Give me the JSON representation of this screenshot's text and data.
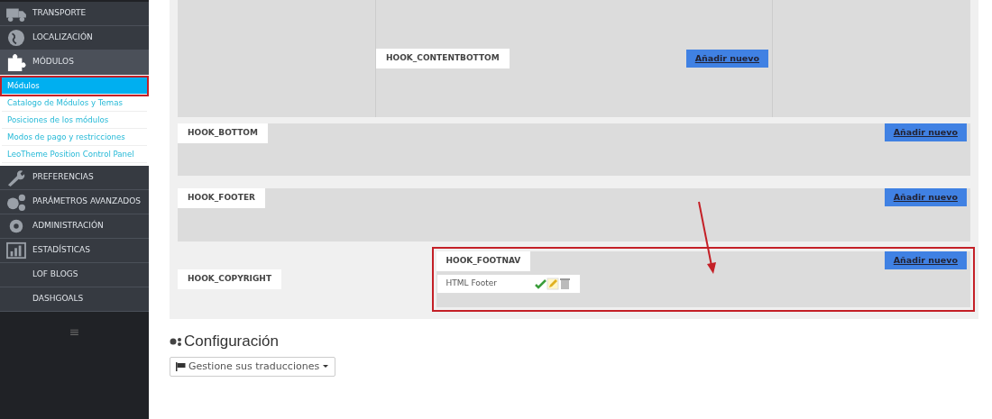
{
  "sidebar": {
    "items": [
      {
        "label": "TRANSPORTE",
        "selected": false
      },
      {
        "label": "LOCALIZACIÓN",
        "selected": false
      },
      {
        "label": "MÓDULOS",
        "selected": true,
        "children": [
          {
            "label": "Módulos",
            "selected": true,
            "highlighted": true
          },
          {
            "label": "Catalogo de Módulos y Temas",
            "selected": false,
            "highlighted": false
          },
          {
            "label": "Posiciones de los módulos",
            "selected": false,
            "highlighted": false
          },
          {
            "label": "Modos de pago y restricciones",
            "selected": false,
            "highlighted": false
          },
          {
            "label": "LeoTheme Position Control Panel",
            "selected": false,
            "highlighted": false
          }
        ]
      },
      {
        "label": "PREFERENCIAS",
        "selected": false
      },
      {
        "label": "PARÁMETROS AVANZADOS",
        "selected": false
      },
      {
        "label": "ADMINISTRACIÓN",
        "selected": false
      },
      {
        "label": "ESTADÍSTICAS",
        "selected": false
      },
      {
        "label": "LOF BLOGS",
        "selected": false
      },
      {
        "label": "DASHGOALS",
        "selected": false
      }
    ],
    "collapse": "≡"
  },
  "rows": [
    {
      "hooks": [
        {
          "name": "HOOK_CONTENTBOTTOM",
          "kind": "columns",
          "button": "Añadir nuevo",
          "highlighted": false
        }
      ]
    },
    {
      "hooks": [
        {
          "name": "HOOK_BOTTOM",
          "kind": "full",
          "button": "Añadir nuevo",
          "highlighted": false
        }
      ]
    },
    {
      "hooks": [
        {
          "name": "HOOK_FOOTER",
          "kind": "full",
          "button": "Añadir nuevo",
          "highlighted": false
        }
      ]
    },
    {
      "hooks": [
        {
          "name": "HOOK_COPYRIGHT",
          "kind": "bare",
          "highlighted": false
        },
        {
          "name": "HOOK_FOOTNAV",
          "kind": "full",
          "button": "Añadir nuevo",
          "highlighted": true,
          "modules": [
            {
              "name": "HTML Footer"
            }
          ]
        }
      ]
    }
  ],
  "config": {
    "title": "Configuración",
    "button": "Gestione sus traducciones"
  }
}
